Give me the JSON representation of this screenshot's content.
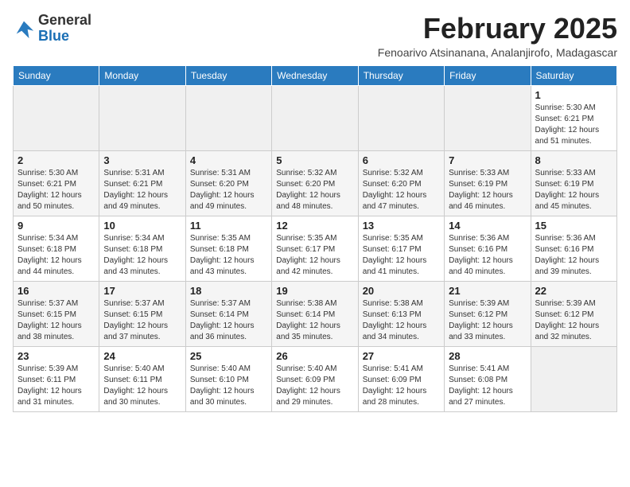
{
  "logo": {
    "general": "General",
    "blue": "Blue"
  },
  "title": "February 2025",
  "subtitle": "Fenoarivo Atsinanana, Analanjirofo, Madagascar",
  "days_of_week": [
    "Sunday",
    "Monday",
    "Tuesday",
    "Wednesday",
    "Thursday",
    "Friday",
    "Saturday"
  ],
  "weeks": [
    [
      {
        "num": "",
        "info": ""
      },
      {
        "num": "",
        "info": ""
      },
      {
        "num": "",
        "info": ""
      },
      {
        "num": "",
        "info": ""
      },
      {
        "num": "",
        "info": ""
      },
      {
        "num": "",
        "info": ""
      },
      {
        "num": "1",
        "info": "Sunrise: 5:30 AM\nSunset: 6:21 PM\nDaylight: 12 hours\nand 51 minutes."
      }
    ],
    [
      {
        "num": "2",
        "info": "Sunrise: 5:30 AM\nSunset: 6:21 PM\nDaylight: 12 hours\nand 50 minutes."
      },
      {
        "num": "3",
        "info": "Sunrise: 5:31 AM\nSunset: 6:21 PM\nDaylight: 12 hours\nand 49 minutes."
      },
      {
        "num": "4",
        "info": "Sunrise: 5:31 AM\nSunset: 6:20 PM\nDaylight: 12 hours\nand 49 minutes."
      },
      {
        "num": "5",
        "info": "Sunrise: 5:32 AM\nSunset: 6:20 PM\nDaylight: 12 hours\nand 48 minutes."
      },
      {
        "num": "6",
        "info": "Sunrise: 5:32 AM\nSunset: 6:20 PM\nDaylight: 12 hours\nand 47 minutes."
      },
      {
        "num": "7",
        "info": "Sunrise: 5:33 AM\nSunset: 6:19 PM\nDaylight: 12 hours\nand 46 minutes."
      },
      {
        "num": "8",
        "info": "Sunrise: 5:33 AM\nSunset: 6:19 PM\nDaylight: 12 hours\nand 45 minutes."
      }
    ],
    [
      {
        "num": "9",
        "info": "Sunrise: 5:34 AM\nSunset: 6:18 PM\nDaylight: 12 hours\nand 44 minutes."
      },
      {
        "num": "10",
        "info": "Sunrise: 5:34 AM\nSunset: 6:18 PM\nDaylight: 12 hours\nand 43 minutes."
      },
      {
        "num": "11",
        "info": "Sunrise: 5:35 AM\nSunset: 6:18 PM\nDaylight: 12 hours\nand 43 minutes."
      },
      {
        "num": "12",
        "info": "Sunrise: 5:35 AM\nSunset: 6:17 PM\nDaylight: 12 hours\nand 42 minutes."
      },
      {
        "num": "13",
        "info": "Sunrise: 5:35 AM\nSunset: 6:17 PM\nDaylight: 12 hours\nand 41 minutes."
      },
      {
        "num": "14",
        "info": "Sunrise: 5:36 AM\nSunset: 6:16 PM\nDaylight: 12 hours\nand 40 minutes."
      },
      {
        "num": "15",
        "info": "Sunrise: 5:36 AM\nSunset: 6:16 PM\nDaylight: 12 hours\nand 39 minutes."
      }
    ],
    [
      {
        "num": "16",
        "info": "Sunrise: 5:37 AM\nSunset: 6:15 PM\nDaylight: 12 hours\nand 38 minutes."
      },
      {
        "num": "17",
        "info": "Sunrise: 5:37 AM\nSunset: 6:15 PM\nDaylight: 12 hours\nand 37 minutes."
      },
      {
        "num": "18",
        "info": "Sunrise: 5:37 AM\nSunset: 6:14 PM\nDaylight: 12 hours\nand 36 minutes."
      },
      {
        "num": "19",
        "info": "Sunrise: 5:38 AM\nSunset: 6:14 PM\nDaylight: 12 hours\nand 35 minutes."
      },
      {
        "num": "20",
        "info": "Sunrise: 5:38 AM\nSunset: 6:13 PM\nDaylight: 12 hours\nand 34 minutes."
      },
      {
        "num": "21",
        "info": "Sunrise: 5:39 AM\nSunset: 6:12 PM\nDaylight: 12 hours\nand 33 minutes."
      },
      {
        "num": "22",
        "info": "Sunrise: 5:39 AM\nSunset: 6:12 PM\nDaylight: 12 hours\nand 32 minutes."
      }
    ],
    [
      {
        "num": "23",
        "info": "Sunrise: 5:39 AM\nSunset: 6:11 PM\nDaylight: 12 hours\nand 31 minutes."
      },
      {
        "num": "24",
        "info": "Sunrise: 5:40 AM\nSunset: 6:11 PM\nDaylight: 12 hours\nand 30 minutes."
      },
      {
        "num": "25",
        "info": "Sunrise: 5:40 AM\nSunset: 6:10 PM\nDaylight: 12 hours\nand 30 minutes."
      },
      {
        "num": "26",
        "info": "Sunrise: 5:40 AM\nSunset: 6:09 PM\nDaylight: 12 hours\nand 29 minutes."
      },
      {
        "num": "27",
        "info": "Sunrise: 5:41 AM\nSunset: 6:09 PM\nDaylight: 12 hours\nand 28 minutes."
      },
      {
        "num": "28",
        "info": "Sunrise: 5:41 AM\nSunset: 6:08 PM\nDaylight: 12 hours\nand 27 minutes."
      },
      {
        "num": "",
        "info": ""
      }
    ]
  ]
}
